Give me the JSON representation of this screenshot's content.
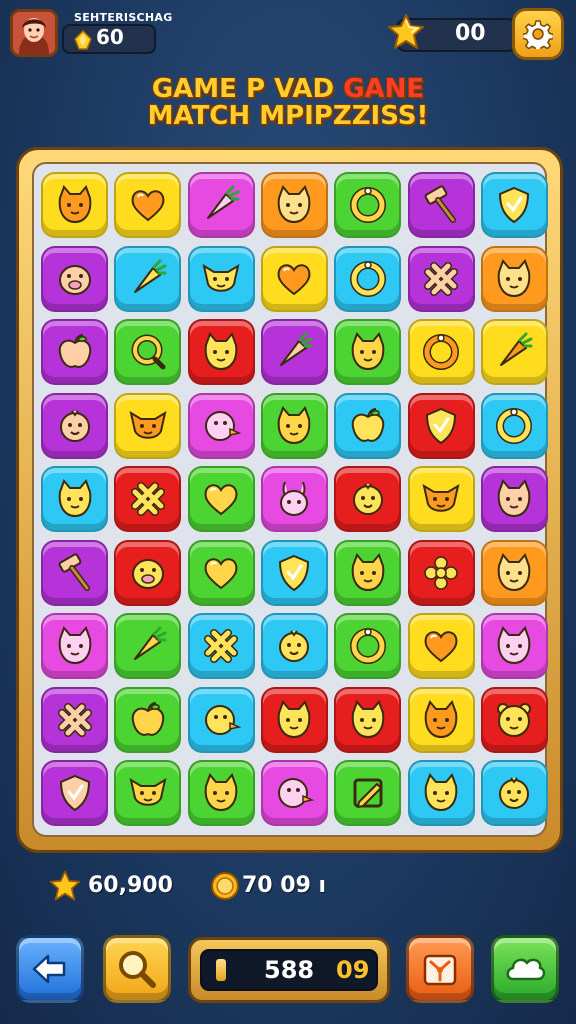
{
  "header": {
    "player_name": "SEHTERISCHAG",
    "player_coins": "60",
    "star_count": "00"
  },
  "title": {
    "line1_part1": "GAME P VAD ",
    "line1_part2": "GANE",
    "line2": "MATCH  MPIPZZISS!"
  },
  "colors": {
    "yellow": "#ffdc1e",
    "green": "#4cd432",
    "pink": "#e64ae0",
    "orange": "#ff9a1e",
    "cyan": "#2ec8f5",
    "purple": "#b533d8",
    "red": "#e61e1e"
  },
  "board": {
    "rows": [
      [
        {
          "color": "yellow",
          "icon": "cat-face-icon"
        },
        {
          "color": "yellow",
          "icon": "heart-icon"
        },
        {
          "color": "pink",
          "icon": "carrot-icon"
        },
        {
          "color": "orange",
          "icon": "cat-face-icon"
        },
        {
          "color": "green",
          "icon": "ring-icon"
        },
        {
          "color": "purple",
          "icon": "hammer-icon"
        },
        {
          "color": "cyan",
          "icon": "shield-icon"
        }
      ],
      [
        {
          "color": "purple",
          "icon": "pig-face-icon"
        },
        {
          "color": "cyan",
          "icon": "carrot-icon"
        },
        {
          "color": "cyan",
          "icon": "fox-face-icon"
        },
        {
          "color": "yellow",
          "icon": "heart-icon"
        },
        {
          "color": "cyan",
          "icon": "ring-icon"
        },
        {
          "color": "purple",
          "icon": "knot-icon"
        },
        {
          "color": "orange",
          "icon": "cat-face-icon"
        }
      ],
      [
        {
          "color": "purple",
          "icon": "apple-icon"
        },
        {
          "color": "green",
          "icon": "magnifier-icon"
        },
        {
          "color": "red",
          "icon": "cat-face-icon"
        },
        {
          "color": "purple",
          "icon": "carrot-icon"
        },
        {
          "color": "green",
          "icon": "cat-face-icon"
        },
        {
          "color": "yellow",
          "icon": "ring-icon"
        },
        {
          "color": "yellow",
          "icon": "carrot-icon"
        }
      ],
      [
        {
          "color": "purple",
          "icon": "chick-face-icon"
        },
        {
          "color": "yellow",
          "icon": "fox-face-icon"
        },
        {
          "color": "pink",
          "icon": "bird-face-icon"
        },
        {
          "color": "green",
          "icon": "cat-face-icon"
        },
        {
          "color": "cyan",
          "icon": "apple-icon"
        },
        {
          "color": "red",
          "icon": "shield-icon"
        },
        {
          "color": "cyan",
          "icon": "ring-icon"
        }
      ],
      [
        {
          "color": "cyan",
          "icon": "cat-face-icon"
        },
        {
          "color": "red",
          "icon": "knot-icon"
        },
        {
          "color": "green",
          "icon": "heart-icon"
        },
        {
          "color": "pink",
          "icon": "bunny-face-icon"
        },
        {
          "color": "red",
          "icon": "chick-face-icon"
        },
        {
          "color": "yellow",
          "icon": "fox-face-icon"
        },
        {
          "color": "purple",
          "icon": "cat-face-icon"
        }
      ],
      [
        {
          "color": "purple",
          "icon": "hammer-icon"
        },
        {
          "color": "red",
          "icon": "pig-face-icon"
        },
        {
          "color": "green",
          "icon": "heart-icon"
        },
        {
          "color": "cyan",
          "icon": "shield-icon"
        },
        {
          "color": "green",
          "icon": "cat-face-icon"
        },
        {
          "color": "red",
          "icon": "flower-icon"
        },
        {
          "color": "orange",
          "icon": "cat-face-icon"
        }
      ],
      [
        {
          "color": "pink",
          "icon": "cat-face-icon"
        },
        {
          "color": "green",
          "icon": "carrot-icon"
        },
        {
          "color": "cyan",
          "icon": "knot-icon"
        },
        {
          "color": "cyan",
          "icon": "chick-face-icon"
        },
        {
          "color": "green",
          "icon": "ring-icon"
        },
        {
          "color": "yellow",
          "icon": "heart-icon"
        },
        {
          "color": "pink",
          "icon": "cat-face-icon"
        }
      ],
      [
        {
          "color": "purple",
          "icon": "knot-icon"
        },
        {
          "color": "green",
          "icon": "apple-icon"
        },
        {
          "color": "cyan",
          "icon": "bird-face-icon"
        },
        {
          "color": "red",
          "icon": "cat-face-icon"
        },
        {
          "color": "red",
          "icon": "cat-face-icon"
        },
        {
          "color": "yellow",
          "icon": "cat-face-icon"
        },
        {
          "color": "red",
          "icon": "bear-face-icon"
        }
      ],
      [
        {
          "color": "purple",
          "icon": "shield-icon"
        },
        {
          "color": "green",
          "icon": "fox-face-icon"
        },
        {
          "color": "green",
          "icon": "cat-face-icon"
        },
        {
          "color": "pink",
          "icon": "bird-face-icon"
        },
        {
          "color": "green",
          "icon": "pencil-icon"
        },
        {
          "color": "cyan",
          "icon": "cat-face-icon"
        },
        {
          "color": "cyan",
          "icon": "chick-face-icon"
        }
      ]
    ]
  },
  "stats": {
    "score": "60,900",
    "coins": "70 09 ı"
  },
  "footer": {
    "level_value": "588",
    "level_moves": "09"
  }
}
